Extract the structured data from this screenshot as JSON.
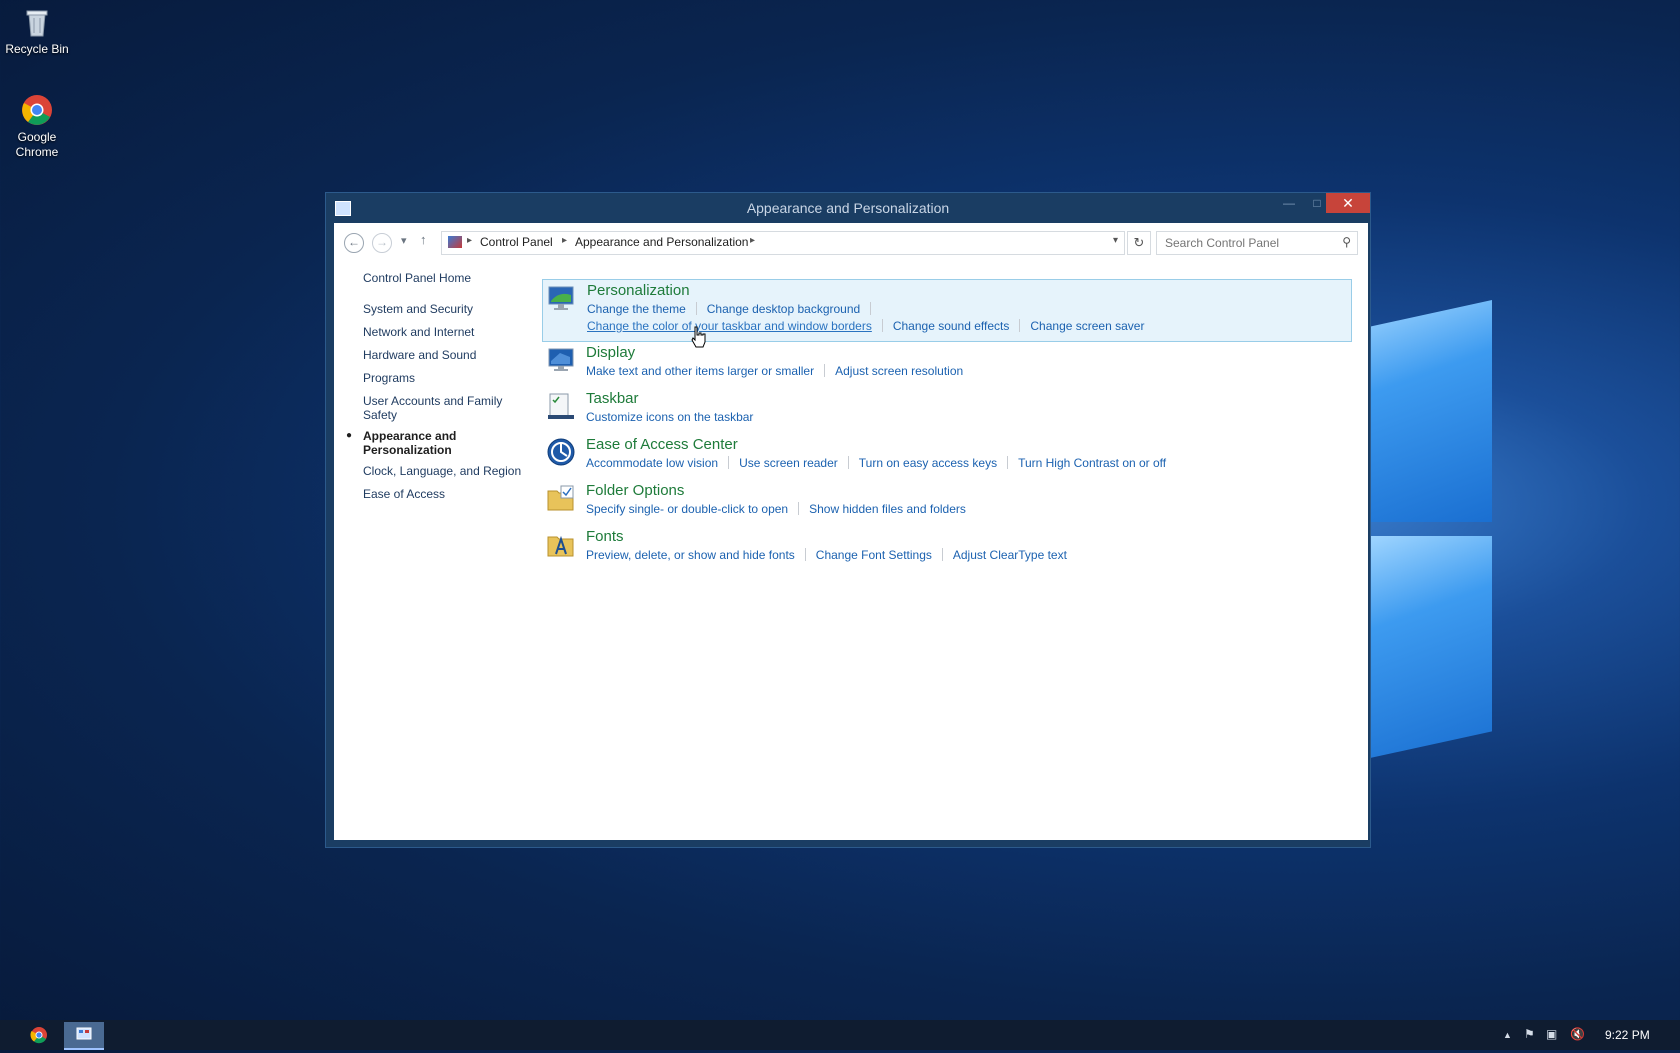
{
  "desktop": {
    "icons": [
      {
        "label": "Recycle Bin"
      },
      {
        "label": "Google Chrome"
      }
    ]
  },
  "window": {
    "title": "Appearance and Personalization",
    "close_glyph": "✕",
    "address": {
      "crumbs": [
        "Control Panel",
        "Appearance and Personalization"
      ]
    },
    "search": {
      "placeholder": "Search Control Panel"
    },
    "leftnav": {
      "home": "Control Panel Home",
      "items": [
        "System and Security",
        "Network and Internet",
        "Hardware and Sound",
        "Programs",
        "User Accounts and Family Safety",
        "Appearance and Personalization",
        "Clock, Language, and Region",
        "Ease of Access"
      ]
    },
    "categories": [
      {
        "title": "Personalization",
        "tasks_row1": [
          "Change the theme",
          "Change desktop background"
        ],
        "tasks_row2": [
          "Change the color of your taskbar and window borders",
          "Change sound effects",
          "Change screen saver"
        ]
      },
      {
        "title": "Display",
        "tasks": [
          "Make text and other items larger or smaller",
          "Adjust screen resolution"
        ]
      },
      {
        "title": "Taskbar",
        "tasks": [
          "Customize icons on the taskbar"
        ]
      },
      {
        "title": "Ease of Access Center",
        "tasks": [
          "Accommodate low vision",
          "Use screen reader",
          "Turn on easy access keys",
          "Turn High Contrast on or off"
        ]
      },
      {
        "title": "Folder Options",
        "tasks": [
          "Specify single- or double-click to open",
          "Show hidden files and folders"
        ]
      },
      {
        "title": "Fonts",
        "tasks": [
          "Preview, delete, or show and hide fonts",
          "Change Font Settings",
          "Adjust ClearType text"
        ]
      }
    ]
  },
  "taskbar": {
    "clock": "9:22 PM"
  },
  "colors": {
    "link": "#1c62b0",
    "category_title": "#1e7b3a",
    "highlight_bg": "#e6f3fb",
    "close_button": "#c7443a"
  }
}
